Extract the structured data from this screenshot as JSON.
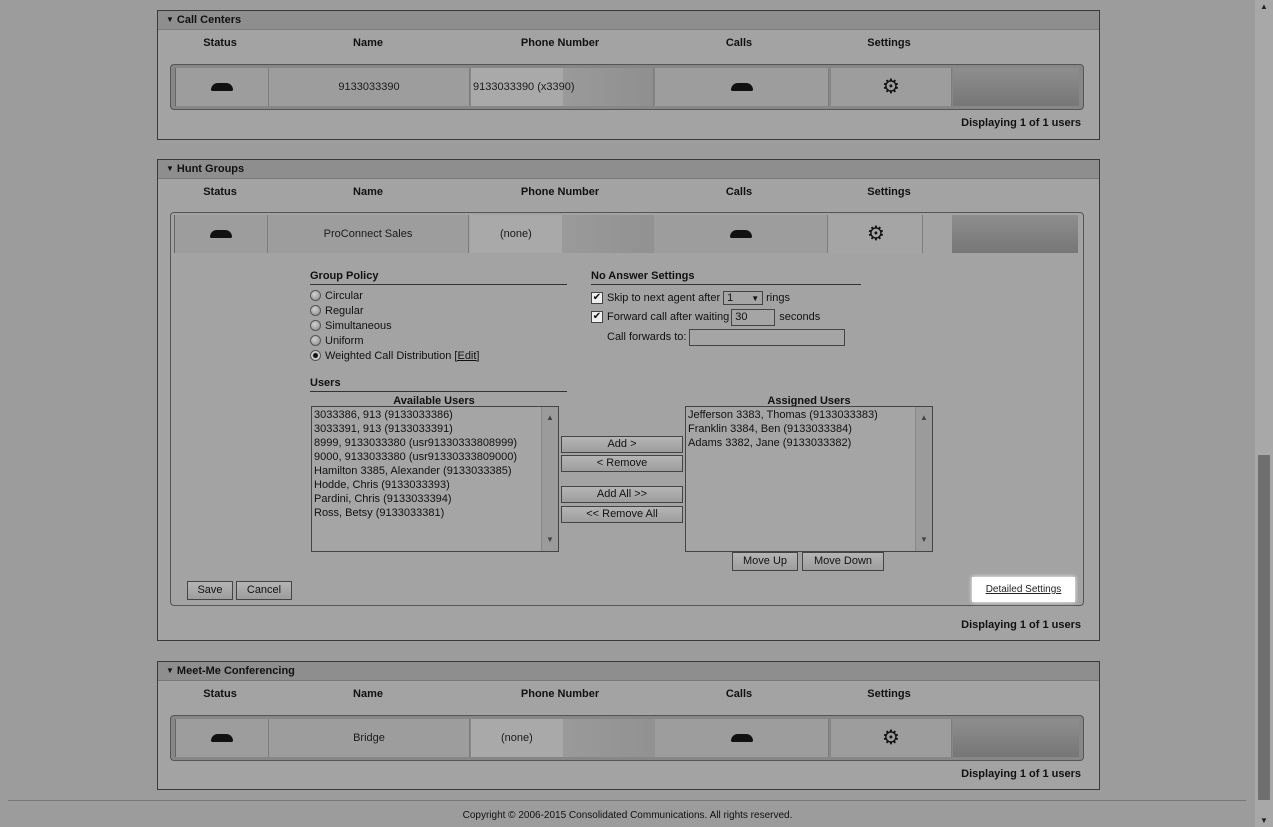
{
  "columns": [
    "Status",
    "Name",
    "Phone Number",
    "Calls",
    "Settings"
  ],
  "call_centers": {
    "title": "Call Centers",
    "row": {
      "name": "9133033390",
      "phone": "9133033390 (x3390)"
    },
    "displaying": "Displaying 1 of 1 users"
  },
  "hunt_groups": {
    "title": "Hunt Groups",
    "row": {
      "name": "ProConnect Sales",
      "phone": "(none)"
    },
    "group_policy": {
      "heading": "Group Policy",
      "options": [
        "Circular",
        "Regular",
        "Simultaneous",
        "Uniform",
        "Weighted Call Distribution"
      ],
      "selected": "Weighted Call Distribution",
      "edit_link": "[Edit]"
    },
    "no_answer": {
      "heading": "No Answer Settings",
      "skip_label": "Skip to next agent after",
      "skip_value": "1",
      "rings_label": "rings",
      "forward_label": "Forward call after waiting",
      "forward_value": "30",
      "seconds_label": "seconds",
      "forwards_to_label": "Call forwards to:",
      "forwards_to_value": ""
    },
    "users": {
      "heading": "Users",
      "available_heading": "Available Users",
      "available": [
        "3033386, 913 (9133033386)",
        "3033391, 913 (9133033391)",
        "8999, 9133033380 (usr91330333808999)",
        "9000, 9133033380 (usr91330333809000)",
        "Hamilton 3385, Alexander (9133033385)",
        "Hodde, Chris (9133033393)",
        "Pardini, Chris (9133033394)",
        "Ross, Betsy (9133033381)"
      ],
      "assigned_heading": "Assigned Users",
      "assigned": [
        "Jefferson 3383, Thomas (9133033383)",
        "Franklin 3384, Ben (9133033384)",
        "Adams 3382, Jane (9133033382)"
      ],
      "add": "Add >",
      "remove": "< Remove",
      "add_all": "Add All >>",
      "remove_all": "<< Remove All",
      "move_up": "Move Up",
      "move_down": "Move Down"
    },
    "save": "Save",
    "cancel": "Cancel",
    "detailed_settings": "Detailed Settings",
    "displaying": "Displaying 1 of 1 users"
  },
  "meet_me": {
    "title": "Meet-Me Conferencing",
    "row": {
      "name": "Bridge",
      "phone": "(none)"
    },
    "displaying": "Displaying 1 of 1 users"
  },
  "copyright": "Copyright © 2006-2015 Consolidated Communications. All rights reserved."
}
